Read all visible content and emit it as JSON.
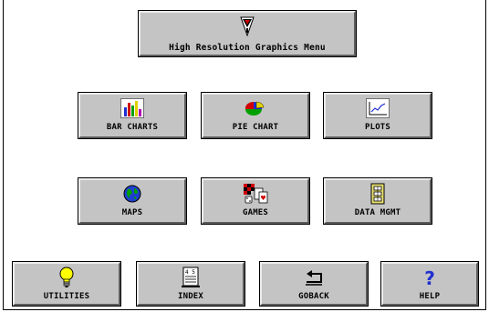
{
  "header": {
    "title": "High Resolution Graphics Menu",
    "icon": "sas-logo-icon"
  },
  "menu": {
    "row1": [
      {
        "label": "BAR CHARTS",
        "icon": "bar-chart-icon"
      },
      {
        "label": "PIE CHART",
        "icon": "pie-chart-icon"
      },
      {
        "label": "PLOTS",
        "icon": "line-plot-icon"
      }
    ],
    "row2": [
      {
        "label": "MAPS",
        "icon": "globe-icon"
      },
      {
        "label": "GAMES",
        "icon": "games-icon"
      },
      {
        "label": "DATA MGMT",
        "icon": "data-file-icon"
      }
    ]
  },
  "toolbar": {
    "items": [
      {
        "label": "UTILITIES",
        "icon": "lightbulb-icon"
      },
      {
        "label": "INDEX",
        "icon": "index-icon"
      },
      {
        "label": "GOBACK",
        "icon": "return-arrow-icon"
      },
      {
        "label": "HELP",
        "icon": "question-icon"
      }
    ]
  }
}
